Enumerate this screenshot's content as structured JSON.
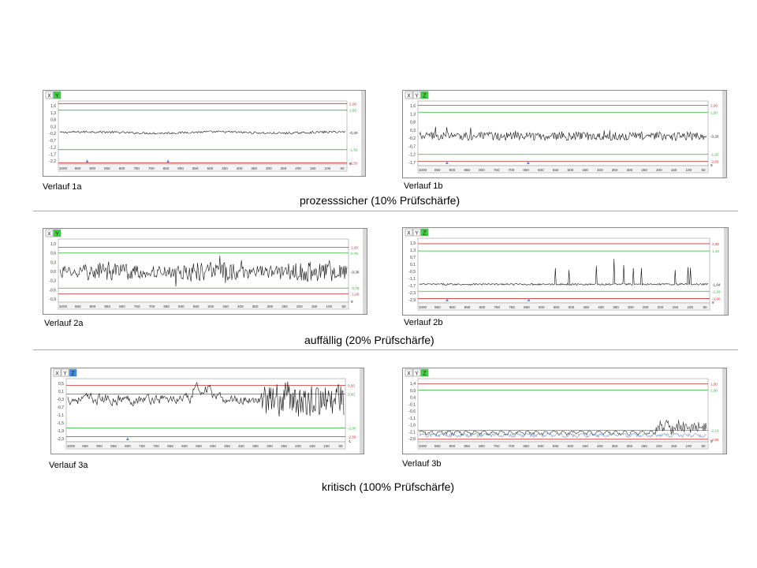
{
  "sections": [
    {
      "label": "prozesssicher (10% Prüfschärfe)"
    },
    {
      "label": "auffällig  (20% Prüfschärfe)"
    },
    {
      "label": "kritisch (100% Prüfschärfe)"
    }
  ],
  "chart_data": [
    {
      "type": "line",
      "caption": "Verlauf 1a",
      "tabs": [
        "X",
        "Y"
      ],
      "active_tab_color": "#3fd23f",
      "yticks": [
        "1,6",
        "1,3",
        "0,8",
        "0,3",
        "-0,2",
        "-0,7",
        "-1,2",
        "-1,7",
        "-2,2"
      ],
      "xticks": [
        "1000",
        "950",
        "900",
        "850",
        "800",
        "750",
        "700",
        "650",
        "600",
        "550",
        "500",
        "450",
        "400",
        "350",
        "300",
        "250",
        "200",
        "150",
        "100",
        "50"
      ],
      "ylim": [
        -2.6,
        2.2
      ],
      "limits": [
        {
          "value": 2.0,
          "label": "2,00",
          "color": "#d23030"
        },
        {
          "value": 1.5,
          "label": "1,50",
          "color": "#2fb52f"
        },
        {
          "value": -1.5,
          "label": "-1,50",
          "color": "#2fb52f"
        },
        {
          "value": -2.5,
          "label": "-2,50",
          "color": "#d23030"
        }
      ],
      "current_label": "-0,20",
      "bottom_label": "9",
      "series": [
        {
          "base": -0.2,
          "amp": 0.08,
          "pattern": "noise_low"
        }
      ],
      "markers_x": [
        900,
        620
      ]
    },
    {
      "type": "line",
      "caption": "Verlauf 1b",
      "tabs": [
        "X",
        "Y",
        "Z"
      ],
      "active_tab_color": "#3fd23f",
      "yticks": [
        "1,6",
        "1,3",
        "0,8",
        "0,3",
        "-0,2",
        "-0,7",
        "-1,2",
        "-1,7"
      ],
      "xticks": [
        "1000",
        "950",
        "900",
        "850",
        "800",
        "750",
        "700",
        "650",
        "600",
        "550",
        "500",
        "450",
        "400",
        "350",
        "300",
        "250",
        "200",
        "150",
        "100",
        "50"
      ],
      "ylim": [
        -2.3,
        2.3
      ],
      "limits": [
        {
          "value": 2.0,
          "label": "2,00",
          "color": "#d23030"
        },
        {
          "value": 1.5,
          "label": "1,50",
          "color": "#2fb52f"
        },
        {
          "value": -1.5,
          "label": "-1,50",
          "color": "#2fb52f"
        },
        {
          "value": -2.0,
          "label": "-2,00",
          "color": "#d23030"
        }
      ],
      "current_label": "-0,20",
      "bottom_label": "9",
      "series": [
        {
          "base": -0.2,
          "amp": 0.3,
          "pattern": "noise_mid"
        }
      ],
      "markers_x": [
        900,
        620
      ]
    },
    {
      "type": "line",
      "caption": "Verlauf 2a",
      "tabs": [
        "X",
        "Y"
      ],
      "active_tab_color": "#3fd23f",
      "yticks": [
        "1,0",
        "0,6",
        "0,3",
        "0,0",
        "-0,3",
        "-0,6",
        "-0,9"
      ],
      "xticks": [
        "1000",
        "950",
        "900",
        "850",
        "800",
        "750",
        "700",
        "650",
        "600",
        "550",
        "500",
        "450",
        "400",
        "350",
        "300",
        "250",
        "200",
        "150",
        "100",
        "50"
      ],
      "ylim": [
        -1.35,
        1.35
      ],
      "limits": [
        {
          "value": 1.0,
          "label": "1,00",
          "color": "#d23030"
        },
        {
          "value": 0.75,
          "label": "0,75",
          "color": "#2fb52f"
        },
        {
          "value": -0.75,
          "label": "-0,75",
          "color": "#2fb52f"
        },
        {
          "value": -1.0,
          "label": "-1,00",
          "color": "#d23030"
        }
      ],
      "current_label": "-0,36",
      "bottom_label": "9",
      "series": [
        {
          "base": -0.05,
          "amp": 0.35,
          "pattern": "noise_high"
        }
      ],
      "markers_x": []
    },
    {
      "type": "line",
      "caption": "Verlauf 2b",
      "tabs": [
        "X",
        "Y",
        "Z"
      ],
      "active_tab_color": "#3fd23f",
      "yticks": [
        "1,9",
        "1,3",
        "0,7",
        "0,1",
        "-0,5",
        "-1,1",
        "-1,7",
        "-2,3",
        "-2,9"
      ],
      "xticks": [
        "1000",
        "950",
        "900",
        "850",
        "800",
        "750",
        "700",
        "650",
        "600",
        "550",
        "500",
        "450",
        "400",
        "350",
        "300",
        "250",
        "200",
        "150",
        "100",
        "50"
      ],
      "ylim": [
        -3.4,
        2.5
      ],
      "limits": [
        {
          "value": 2.0,
          "label": "2,00",
          "color": "#d23030"
        },
        {
          "value": 1.34,
          "label": "1,34",
          "color": "#2fb52f"
        },
        {
          "value": -2.34,
          "label": "-2,34",
          "color": "#2fb52f"
        },
        {
          "value": -3.0,
          "label": "-3,00",
          "color": "#d23030"
        }
      ],
      "current_label": "-1,64",
      "bottom_label": "9",
      "series": [
        {
          "base": -1.7,
          "amp": 0.08,
          "pattern": "spikes"
        }
      ],
      "markers_x": [
        900,
        620
      ]
    },
    {
      "type": "line",
      "caption": "Verlauf 3a",
      "tabs": [
        "X",
        "Y",
        "Z"
      ],
      "active_tab_color": "#3a8ee6",
      "yticks": [
        "0,5",
        "0,1",
        "-0,3",
        "-0,7",
        "-1,1",
        "-1,5",
        "-1,9",
        "-2,3"
      ],
      "xticks": [
        "1000",
        "950",
        "900",
        "850",
        "800",
        "750",
        "700",
        "650",
        "600",
        "550",
        "500",
        "450",
        "400",
        "350",
        "300",
        "250",
        "200",
        "150",
        "100",
        "50"
      ],
      "ylim": [
        -2.8,
        0.9
      ],
      "limits": [
        {
          "value": 0.5,
          "label": "0,50",
          "color": "#d23030"
        },
        {
          "value": 0.0,
          "label": "0,00",
          "color": "#2fb52f"
        },
        {
          "value": -2.0,
          "label": "-2,00",
          "color": "#2fb52f"
        },
        {
          "value": -2.5,
          "label": "-2,50",
          "color": "#d23030"
        }
      ],
      "current_label": "",
      "bottom_label": "-1",
      "series": [
        {
          "base": -0.3,
          "amp": 0.25,
          "pattern": "coarse"
        }
      ],
      "markers_x": [
        780
      ]
    },
    {
      "type": "line",
      "caption": "Verlauf 3b",
      "tabs": [
        "X",
        "Y",
        "Z"
      ],
      "active_tab_color": "#3fd23f",
      "yticks": [
        "1,4",
        "0,9",
        "0,4",
        "-0,1",
        "-0,6",
        "-1,1",
        "-1,6",
        "-2,1",
        "-2,6"
      ],
      "xticks": [
        "1000",
        "950",
        "900",
        "850",
        "800",
        "750",
        "700",
        "650",
        "600",
        "550",
        "500",
        "450",
        "400",
        "350",
        "300",
        "250",
        "200",
        "150",
        "100",
        "50"
      ],
      "ylim": [
        -3.1,
        1.9
      ],
      "limits": [
        {
          "value": 1.5,
          "label": "1,50",
          "color": "#d23030"
        },
        {
          "value": 1.0,
          "label": "1,00",
          "color": "#2fb52f"
        },
        {
          "value": -2.2,
          "label": "-2,21",
          "color": "#2fb52f"
        },
        {
          "value": -2.9,
          "label": "-2,90",
          "color": "#d23030"
        }
      ],
      "current_label": "",
      "bottom_label": "9",
      "series": [
        {
          "base": -2.6,
          "amp": 0.2,
          "pattern": "bumps_dark",
          "color": "#333"
        },
        {
          "base": -2.6,
          "amp": 0.2,
          "pattern": "bumps_blue",
          "color": "#6a8fd8"
        }
      ],
      "markers_x": []
    }
  ]
}
